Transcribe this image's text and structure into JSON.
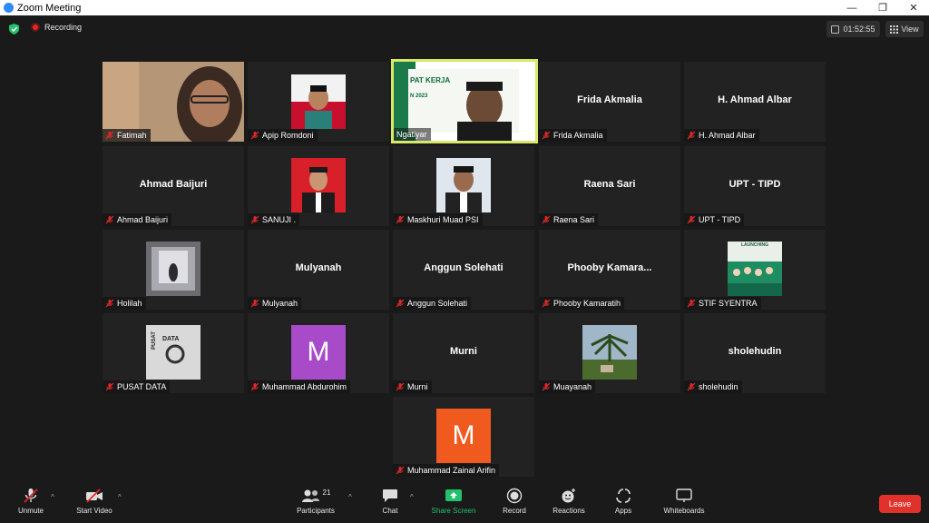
{
  "window": {
    "title": "Zoom Meeting",
    "minimize": "—",
    "restore": "❐",
    "close": "✕"
  },
  "topbar": {
    "recording": "Recording",
    "timer": "01:52:55",
    "view": "View"
  },
  "tiles": [
    {
      "label": "Fatimah",
      "center": "",
      "muted": true
    },
    {
      "label": "Apip Romdoni",
      "center": "",
      "muted": true
    },
    {
      "label": "Ngatiyar",
      "center": "",
      "muted": false,
      "slide_title": "PAT KERJA",
      "slide_year": "N 2023"
    },
    {
      "label": "Frida Akmalia",
      "center": "Frida Akmalia",
      "muted": true
    },
    {
      "label": "H. Ahmad Albar",
      "center": "H. Ahmad Albar",
      "muted": true
    },
    {
      "label": "Ahmad Baijuri",
      "center": "Ahmad Baijuri",
      "muted": true
    },
    {
      "label": "SANUJI .",
      "center": "",
      "muted": true
    },
    {
      "label": "Maskhuri Muad PSI",
      "center": "",
      "muted": true
    },
    {
      "label": "Raena Sari",
      "center": "Raena Sari",
      "muted": true
    },
    {
      "label": "UPT - TIPD",
      "center": "UPT - TIPD",
      "muted": true
    },
    {
      "label": "Holilah",
      "center": "",
      "muted": true
    },
    {
      "label": "Mulyanah",
      "center": "Mulyanah",
      "muted": true
    },
    {
      "label": "Anggun Solehati",
      "center": "Anggun Solehati",
      "muted": true
    },
    {
      "label": "Phooby Kamaratih",
      "center": "Phooby  Kamara...",
      "muted": true
    },
    {
      "label": "STIF SYENTRA",
      "center": "",
      "muted": true,
      "image_text": "LAUNCHING"
    },
    {
      "label": "PUSAT DATA",
      "center": "",
      "muted": true,
      "image_text": "DATA",
      "image_text2": "PUSAT"
    },
    {
      "label": "Muhammad Abdurohim",
      "center": "",
      "muted": true,
      "avatar_letter": "M",
      "avatar_color": "#a84bc8"
    },
    {
      "label": "Murni",
      "center": "Murni",
      "muted": true
    },
    {
      "label": "Muayanah",
      "center": "",
      "muted": true
    },
    {
      "label": "sholehudin",
      "center": "sholehudin",
      "muted": true
    },
    {
      "label": "Muhammad Zainal Arifin",
      "center": "",
      "muted": true,
      "avatar_letter": "M",
      "avatar_color": "#f05a1e"
    }
  ],
  "toolbar": {
    "unmute": "Unmute",
    "start_video": "Start Video",
    "participants": "Participants",
    "participants_count": "21",
    "chat": "Chat",
    "share_screen": "Share Screen",
    "record": "Record",
    "reactions": "Reactions",
    "apps": "Apps",
    "whiteboards": "Whiteboards",
    "leave": "Leave"
  },
  "colors": {
    "accent_green": "#23c16b",
    "leave_red": "#e0312a",
    "active_speaker": "#d8e86a",
    "mute_red": "#e02828"
  }
}
